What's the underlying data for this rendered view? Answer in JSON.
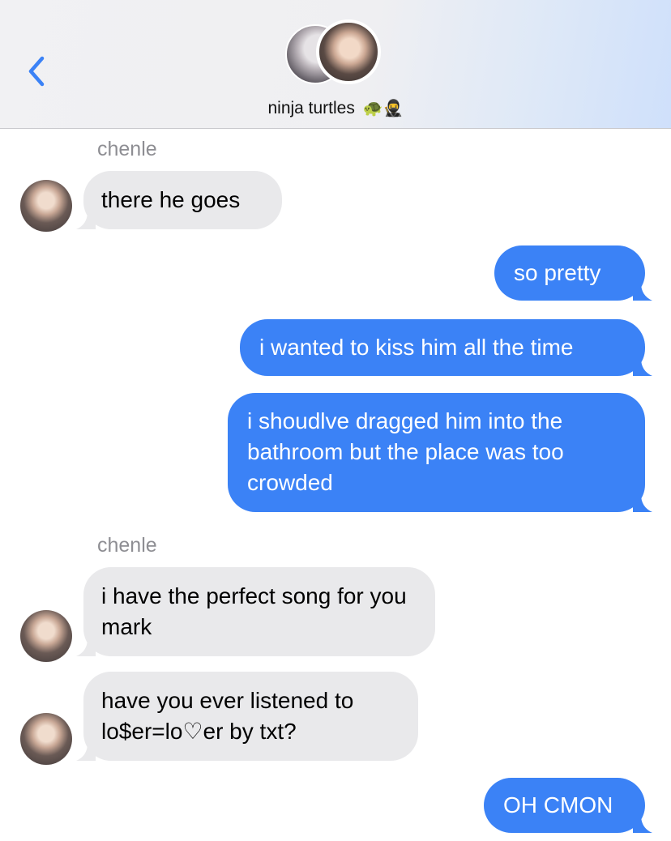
{
  "header": {
    "group_name": "ninja turtles",
    "emojis": "🐢🥷",
    "back_icon": "chevron-left-icon",
    "accent_color": "#3b82f6"
  },
  "messages": [
    {
      "sender": "chenle",
      "direction": "incoming",
      "text": "there he goes"
    },
    {
      "direction": "outgoing",
      "text": "so pretty"
    },
    {
      "direction": "outgoing",
      "text": "i wanted to kiss him all the time"
    },
    {
      "direction": "outgoing",
      "text": "i shoudlve dragged him into the bathroom but the place was too crowded"
    },
    {
      "sender": "chenle",
      "direction": "incoming",
      "text": "i have the perfect song for you mark"
    },
    {
      "direction": "incoming",
      "text": "have you ever listened to lo$er=lo♡er by txt?"
    },
    {
      "direction": "outgoing",
      "text": "OH CMON"
    }
  ],
  "colors": {
    "incoming_bubble": "#e9e9eb",
    "outgoing_bubble": "#3b82f6",
    "sender_label": "#8e8e93"
  }
}
